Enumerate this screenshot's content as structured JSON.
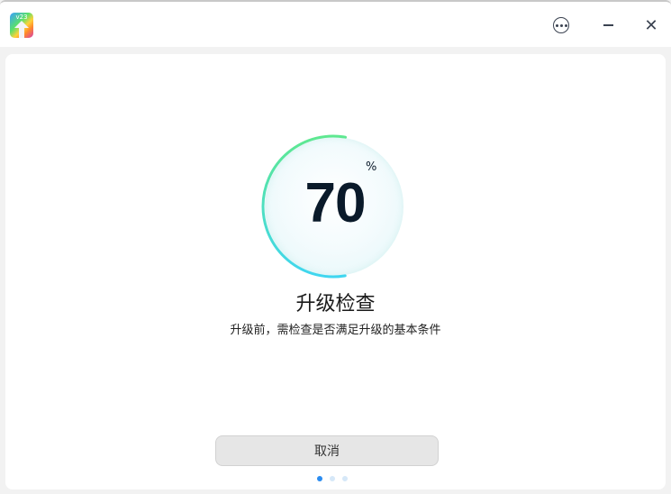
{
  "titlebar": {
    "logo_text": "v23",
    "menu_icon": "more-circle-icon",
    "minimize_icon": "minimize-icon",
    "close_icon": "close-icon",
    "close_glyph": "✕"
  },
  "progress": {
    "value": 70,
    "value_text": "70",
    "unit": "%",
    "fraction": 0.7,
    "ring_colors": [
      "#5ee890",
      "#3fd6f0"
    ]
  },
  "main": {
    "title": "升级检查",
    "description": "升级前，需检查是否满足升级的基本条件"
  },
  "footer": {
    "cancel_label": "取消",
    "page_count": 3,
    "current_page": 1
  }
}
